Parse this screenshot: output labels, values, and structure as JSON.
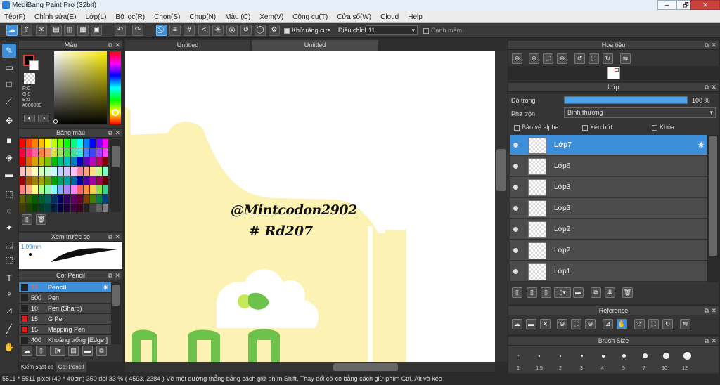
{
  "window": {
    "title": "MediBang Paint Pro (32bit)",
    "minimize": "🗕",
    "maximize": "🗗",
    "close": "✕"
  },
  "menu": [
    "Tệp(F)",
    "Chỉnh sửa(E)",
    "Lớp(L)",
    "Bộ lọc(R)",
    "Chọn(S)",
    "Chụp(N)",
    "Màu (C)",
    "Xem(V)",
    "Công cụ(T)",
    "Cửa sổ(W)",
    "Cloud",
    "Help"
  ],
  "toolbar": {
    "antialias_label": "Khử răng cưa",
    "adjust_label": "Điều chỉnh",
    "adjust_value": "11",
    "edge_label": "Cạnh mềm"
  },
  "color_panel": {
    "title": "Màu",
    "r": "R:0",
    "g": "G:0",
    "b": "B:0",
    "hex": "#000000"
  },
  "palette_panel": {
    "title": "Bảng màu"
  },
  "preview_panel": {
    "title": "Xem trước cọ",
    "size": "1.09mm"
  },
  "brush_panel": {
    "title": "Cọ: Pencil",
    "brushes": [
      {
        "size": "15",
        "name": "Pencil",
        "color": "#222222"
      },
      {
        "size": "500",
        "name": "Pen",
        "color": "#222222"
      },
      {
        "size": "10",
        "name": "Pen (Sharp)",
        "color": "#222222"
      },
      {
        "size": "15",
        "name": "G Pen",
        "color": "#e02020"
      },
      {
        "size": "15",
        "name": "Mapping Pen",
        "color": "#e02020"
      },
      {
        "size": "400",
        "name": "Khoảng trống [Edge ]",
        "color": "#222222"
      }
    ]
  },
  "bottom_tabs": {
    "control": "Kiểm soát co",
    "brush": "Co: Pencil"
  },
  "canvas": {
    "tabs": [
      "Untitled",
      "Untitled"
    ],
    "signature_line1": "@Mintcodon2902",
    "signature_line2": "# Rd207"
  },
  "navigator_panel": {
    "title": "Hoa tiêu"
  },
  "layer_panel": {
    "title": "Lớp",
    "opacity_label": "Độ trong",
    "opacity_value": "100 %",
    "blend_label": "Pha trộn",
    "blend_value": "Bình thường",
    "protect_alpha": "Bảo vệ alpha",
    "clipping": "Xén bớt",
    "lock": "Khóa",
    "layers": [
      "Lớp7",
      "Lớp6",
      "Lớp3",
      "Lớp3",
      "Lớp2",
      "Lớp2",
      "Lớp1"
    ]
  },
  "reference_panel": {
    "title": "Reference"
  },
  "brushsize_panel": {
    "title": "Brush Size",
    "sizes": [
      "1",
      "1.5",
      "2",
      "3",
      "4",
      "5",
      "7",
      "10",
      "12"
    ]
  },
  "status": {
    "text": "5511 * 5511 pixel   (40 * 40cm)   350 dpi   33 %   ( 4593, 2384 )   Vẽ một đường thẳng bằng cách giữ phím Shift, Thay đổi cỡ cọ bằng cách giữ phím Ctrl, Alt và kéo"
  },
  "colors": {
    "accent": "#3d8fd9",
    "canvas_yellow": "#fcf2b4",
    "green": "#6cc24a",
    "lime": "#c6e85a"
  }
}
